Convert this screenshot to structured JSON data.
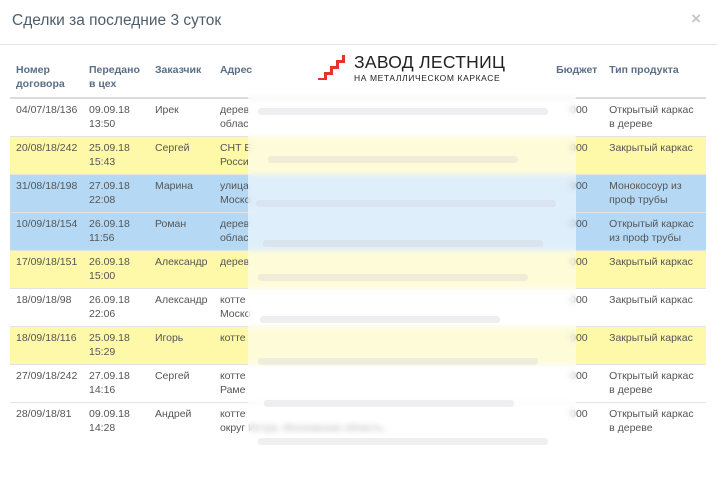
{
  "modal": {
    "title": "Сделки за последние 3 суток",
    "close": "×"
  },
  "logo": {
    "title": "ЗАВОД ЛЕСТНИЦ",
    "subtitle": "НА МЕТАЛЛИЧЕСКОМ КАРКАСЕ",
    "color": "#e3352c"
  },
  "table": {
    "headers": {
      "number": "Номер договора",
      "sent": "Передано в цех",
      "customer": "Заказчик",
      "address": "Адрес",
      "budget": "Бюджет",
      "type": "Тип продукта"
    },
    "rows": [
      {
        "number": "04/07/18/136",
        "date": "09.09.18",
        "time": "13:50",
        "customer": "Ирек",
        "addr1": "дерев",
        "addr2": "облас",
        "budget": "000",
        "type": "Открытый каркас в дереве"
      },
      {
        "number": "20/08/18/242",
        "date": "25.09.18",
        "time": "15:43",
        "customer": "Сергей",
        "addr1": "СНТ Е",
        "addr2": "Росси",
        "budget": "000",
        "type": "Закрытый каркас"
      },
      {
        "number": "31/08/18/198",
        "date": "27.09.18",
        "time": "22:08",
        "customer": "Марина",
        "addr1": "улица",
        "addr2": "Моско",
        "budget": "000",
        "type": "Монокосоур из проф трубы"
      },
      {
        "number": "10/09/18/154",
        "date": "26.09.18",
        "time": "11:56",
        "customer": "Роман",
        "addr1": "дерев",
        "addr2": "облас",
        "budget": "000",
        "type": "Открытый каркас из проф трубы"
      },
      {
        "number": "17/09/18/151",
        "date": "26.09.18",
        "time": "15:00",
        "customer": "Александр",
        "addr1": "дерев",
        "addr2": "",
        "budget": "000",
        "type": "Закрытый каркас"
      },
      {
        "number": "18/09/18/98",
        "date": "26.09.18",
        "time": "22:06",
        "customer": "Александр",
        "addr1": "котте",
        "addr2": "Моско",
        "budget": "000",
        "type": "Закрытый каркас"
      },
      {
        "number": "18/09/18/116",
        "date": "25.09.18",
        "time": "15:29",
        "customer": "Игорь",
        "addr1": "котте",
        "addr2": "",
        "budget": "000",
        "type": "Закрытый каркас"
      },
      {
        "number": "27/09/18/242",
        "date": "27.09.18",
        "time": "14:16",
        "customer": "Сергей",
        "addr1": "котте",
        "addr2": "Раме",
        "budget": "000",
        "type": "Открытый каркас в дереве"
      },
      {
        "number": "28/09/18/81",
        "date": "09.09.18",
        "time": "14:28",
        "customer": "Андрей",
        "addr1": "котте",
        "addr2": "округ Истра, Московская область,",
        "budget": "000",
        "type": "Открытый каркас в дереве"
      }
    ],
    "row_highlight": [
      "none",
      "yellow",
      "blue",
      "blue",
      "yellow",
      "none",
      "yellow",
      "none",
      "none"
    ]
  }
}
